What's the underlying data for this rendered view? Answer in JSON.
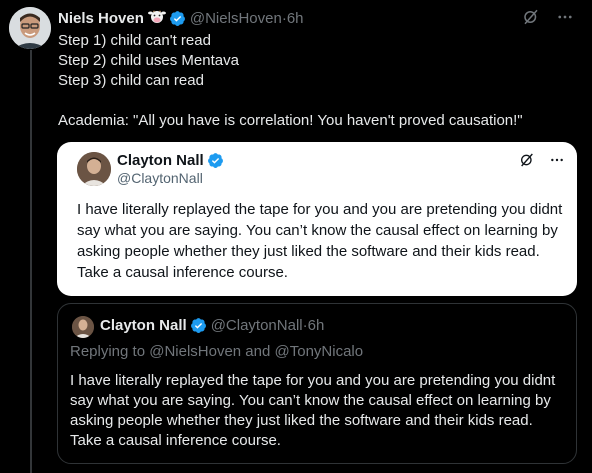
{
  "main": {
    "author_name": "Niels Hoven",
    "handle": "@NielsHoven",
    "separator": " · ",
    "time": "6h",
    "lines": [
      "Step 1) child can't read",
      "Step 2) child uses Mentava",
      "Step 3) child can read",
      "Academia: \"All you have is correlation! You haven't proved causation!\""
    ],
    "icons": [
      "cow-emoji-icon",
      "verified-badge-icon",
      "grok-icon",
      "more-icon"
    ]
  },
  "quote_card": {
    "author_name": "Clayton Nall",
    "handle": "@ClaytonNall",
    "text": "I have literally replayed the tape for you and you are pretending you didnt say what you are saying.  You can’t know the causal effect on learning by asking people whether they just liked the software and their kids read.  Take a causal inference course."
  },
  "embedded": {
    "author_name": "Clayton Nall",
    "handle": "@ClaytonNall",
    "separator": " · ",
    "time": "6h",
    "replying_to": "Replying to @NielsHoven and @TonyNicalo",
    "text": "I have literally replayed the tape for you and you are pretending you didnt say what you are saying.  You can’t know the causal effect on learning by asking people whether they just liked the software and their kids read.  Take a causal inference course."
  },
  "colors": {
    "background": "#000000",
    "text": "#e7e9ea",
    "muted": "#71767b",
    "verified": "#1d9bf0",
    "card": "#ffffff"
  }
}
